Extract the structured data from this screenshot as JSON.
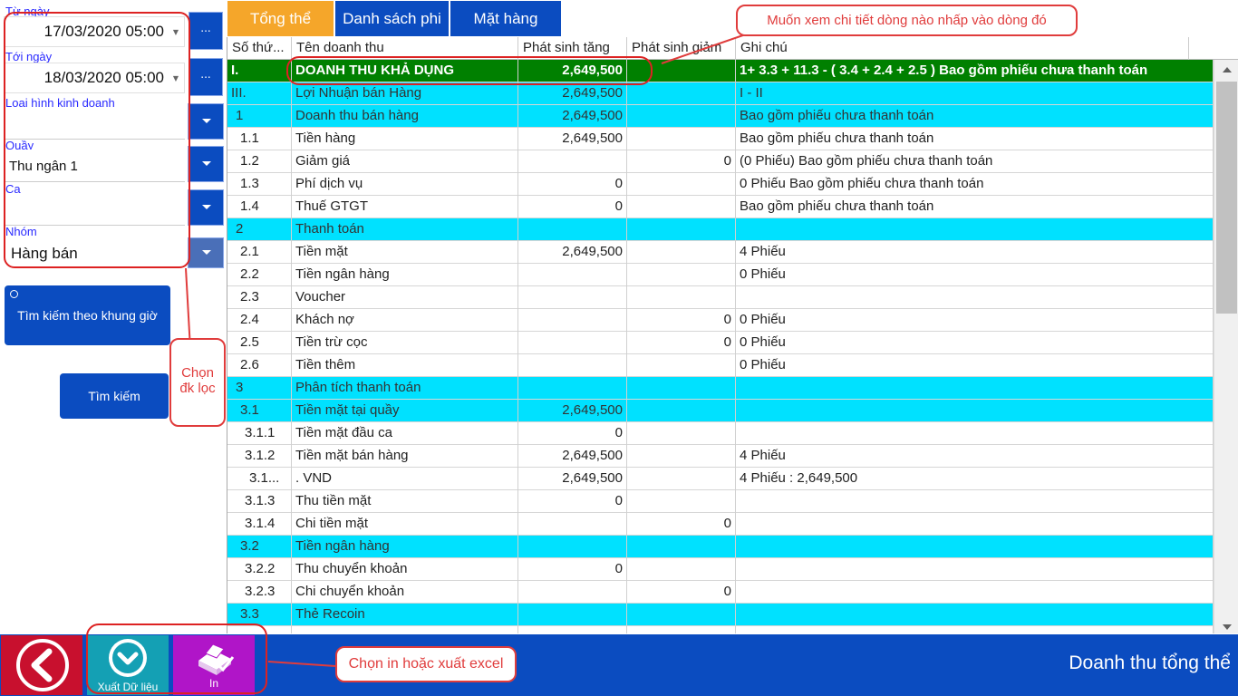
{
  "filters": {
    "from_date": {
      "label": "Từ ngày",
      "value": "17/03/2020 05:00",
      "button": "..."
    },
    "to_date": {
      "label": "Tới ngày",
      "value": "18/03/2020 05:00",
      "button": "..."
    },
    "business_type": {
      "label": "Loại hình kinh doanh",
      "value": ""
    },
    "counter": {
      "label": "Quầy",
      "value": "Thu ngân 1"
    },
    "shift": {
      "label": "Ca",
      "value": ""
    },
    "group": {
      "label": "Nhóm",
      "value": "Hàng bán"
    },
    "time_search_button": "Tìm kiếm theo khung giờ",
    "search_button": "Tìm kiếm"
  },
  "tabs": [
    {
      "label": "Tổng thể",
      "active": true
    },
    {
      "label": "Danh sách phi"
    },
    {
      "label": "Mặt hàng"
    }
  ],
  "grid": {
    "headers": [
      "Số thứ...",
      "Tên doanh thu",
      "Phát sinh tăng",
      "Phát sinh giảm",
      "Ghi chú"
    ],
    "rows": [
      {
        "no": "I.",
        "name": "DOANH THU KHẢ DỤNG",
        "inc": "2,649,500",
        "dec": "",
        "note": "1+ 3.3 + 11.3  - ( 3.4 + 2.4 + 2.5 ) Bao gồm phiếu chưa thanh toán",
        "style": "green",
        "indent": 0
      },
      {
        "no": "III.",
        "name": "Lợi Nhuận bán Hàng",
        "inc": "2,649,500",
        "dec": "",
        "note": "I - II",
        "style": "cyan",
        "indent": 0
      },
      {
        "no": "1",
        "name": "Doanh thu bán hàng",
        "inc": "2,649,500",
        "dec": "",
        "note": "Bao gồm phiếu chưa thanh toán",
        "style": "cyan",
        "indent": 1
      },
      {
        "no": "1.1",
        "name": "Tiền hàng",
        "inc": "2,649,500",
        "dec": "",
        "note": "Bao gồm phiếu chưa thanh toán",
        "style": "white",
        "indent": 2
      },
      {
        "no": "1.2",
        "name": "Giảm giá",
        "inc": "",
        "dec": "0",
        "note": " (0 Phiếu)  Bao gồm phiếu chưa thanh toán",
        "style": "white",
        "indent": 2
      },
      {
        "no": "1.3",
        "name": "Phí dịch vụ",
        "inc": "0",
        "dec": "",
        "note": "0 Phiếu  Bao gồm phiếu chưa thanh toán",
        "style": "white",
        "indent": 2
      },
      {
        "no": "1.4",
        "name": "Thuế GTGT",
        "inc": "0",
        "dec": "",
        "note": "Bao gồm phiếu chưa thanh toán",
        "style": "white",
        "indent": 2
      },
      {
        "no": "2",
        "name": "Thanh toán",
        "inc": "",
        "dec": "",
        "note": "",
        "style": "cyan",
        "indent": 1
      },
      {
        "no": "2.1",
        "name": "Tiền mặt",
        "inc": "2,649,500",
        "dec": "",
        "note": "4 Phiếu",
        "style": "white",
        "indent": 2
      },
      {
        "no": "2.2",
        "name": "Tiền ngân hàng",
        "inc": "",
        "dec": "",
        "note": "0 Phiếu",
        "style": "white",
        "indent": 2
      },
      {
        "no": "2.3",
        "name": "Voucher",
        "inc": "",
        "dec": "",
        "note": "",
        "style": "white",
        "indent": 2
      },
      {
        "no": "2.4",
        "name": "Khách nợ",
        "inc": "",
        "dec": "0",
        "note": "0 Phiếu",
        "style": "white",
        "indent": 2
      },
      {
        "no": "2.5",
        "name": "Tiền trừ cọc",
        "inc": "",
        "dec": "0",
        "note": "0 Phiếu",
        "style": "white",
        "indent": 2
      },
      {
        "no": "2.6",
        "name": "Tiền thêm",
        "inc": "",
        "dec": "",
        "note": "0 Phiếu",
        "style": "white",
        "indent": 2
      },
      {
        "no": "3",
        "name": "Phân tích thanh toán",
        "inc": "",
        "dec": "",
        "note": "",
        "style": "cyan",
        "indent": 1
      },
      {
        "no": "3.1",
        "name": "Tiền mặt tại quầy",
        "inc": "2,649,500",
        "dec": "",
        "note": "",
        "style": "cyan",
        "indent": 2
      },
      {
        "no": "3.1.1",
        "name": "Tiền mặt đầu ca",
        "inc": "0",
        "dec": "",
        "note": "",
        "style": "white",
        "indent": 3
      },
      {
        "no": "3.1.2",
        "name": "Tiền mặt bán hàng",
        "inc": "2,649,500",
        "dec": "",
        "note": "4 Phiếu",
        "style": "white",
        "indent": 3
      },
      {
        "no": "3.1...",
        "name": ".    VND",
        "inc": "2,649,500",
        "dec": "",
        "note": "4 Phiếu : 2,649,500",
        "style": "white",
        "indent": 4
      },
      {
        "no": "3.1.3",
        "name": "Thu tiền mặt",
        "inc": "0",
        "dec": "",
        "note": "",
        "style": "white",
        "indent": 3
      },
      {
        "no": "3.1.4",
        "name": "Chi tiền mặt",
        "inc": "",
        "dec": "0",
        "note": "",
        "style": "white",
        "indent": 3
      },
      {
        "no": "3.2",
        "name": "Tiền ngân hàng",
        "inc": "",
        "dec": "",
        "note": "",
        "style": "cyan",
        "indent": 2
      },
      {
        "no": "3.2.2",
        "name": "Thu chuyển khoản",
        "inc": "0",
        "dec": "",
        "note": "",
        "style": "white",
        "indent": 3
      },
      {
        "no": "3.2.3",
        "name": "Chi chuyển khoản",
        "inc": "",
        "dec": "0",
        "note": "",
        "style": "white",
        "indent": 3
      },
      {
        "no": "3.3",
        "name": "Thẻ Recoin",
        "inc": "",
        "dec": "",
        "note": "",
        "style": "cyan",
        "indent": 2
      },
      {
        "no": "",
        "name": "",
        "inc": "",
        "dec": "",
        "note": "",
        "style": "white",
        "indent": 0
      }
    ]
  },
  "footer": {
    "export_label": "Xuất Dữ liệu",
    "print_label": "In",
    "title": "Doanh thu tổng thể"
  },
  "annotations": {
    "top": "Muốn xem chi tiết dòng nào nhấp vào dòng đó",
    "filter_line1": "Chọn",
    "filter_line2": "đk lọc",
    "bottom": "Chọn in hoặc xuất excel"
  },
  "colors": {
    "primary_blue": "#0b4cc0",
    "tab_active": "#f5a62a",
    "row_green": "#008000",
    "row_cyan": "#00e1ff",
    "back_red": "#c8102e",
    "export_teal": "#14a0b4",
    "print_purple": "#b015c8",
    "annotation_red": "#e03c3c"
  }
}
